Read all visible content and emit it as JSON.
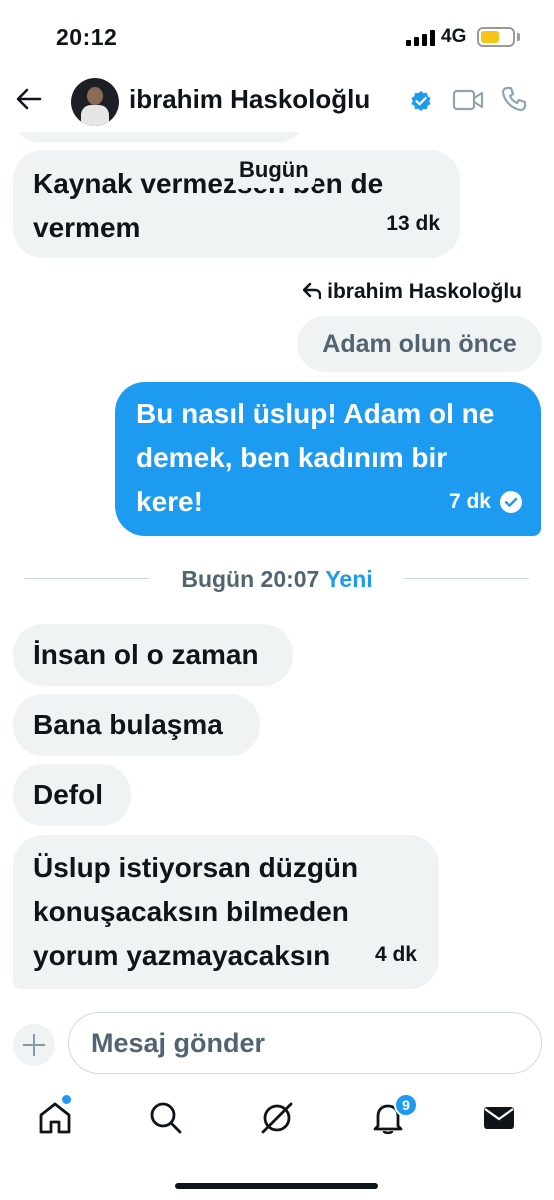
{
  "status_bar": {
    "time": "20:12",
    "network": "4G",
    "battery_level": 0.6,
    "battery_color": "#f5c518"
  },
  "header": {
    "contact_name": "ibrahim Haskoloğlu",
    "verified": true
  },
  "chat": {
    "day_label": "Bugün",
    "messages_top": [
      {
        "direction": "in",
        "text": "Kaynak vermezsen ben de vermem",
        "time": "13 dk"
      }
    ],
    "reply": {
      "label": "ibrahim Haskoloğlu",
      "quoted_text": "Adam olun önce"
    },
    "outgoing": {
      "text": "Bu nasıl üslup! Adam ol ne demek, ben kadınım bir kere!",
      "time": "7 dk",
      "status": "read"
    },
    "divider": {
      "label": "Bugün 20:07",
      "new_label": "Yeni"
    },
    "messages_new": [
      {
        "direction": "in",
        "text": "İnsan ol o zaman"
      },
      {
        "direction": "in",
        "text": "Bana bulaşma"
      },
      {
        "direction": "in",
        "text": "Defol"
      },
      {
        "direction": "in",
        "text": "Üslup istiyorsan düzgün konuşacaksın bilmeden yorum yazmayacaksın",
        "time": "4 dk"
      }
    ]
  },
  "composer": {
    "placeholder": "Mesaj gönder"
  },
  "tabbar": {
    "items": [
      "home-icon",
      "search-icon",
      "grok-icon",
      "notifications-icon",
      "messages-icon"
    ],
    "notifications_badge": "9"
  },
  "colors": {
    "accent": "#1d9bf0",
    "incoming_bubble": "#eff3f4",
    "text": "#0f1419",
    "muted": "#536471"
  }
}
